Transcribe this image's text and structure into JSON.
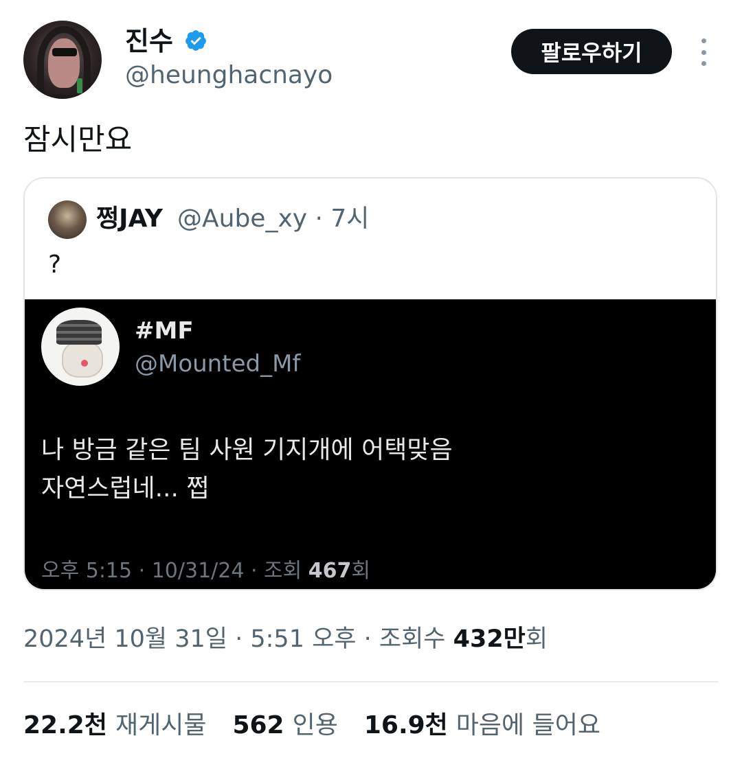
{
  "author": {
    "name": "진수",
    "handle": "@heunghacnayo",
    "verified": true,
    "verified_color": "#1d9bf0"
  },
  "follow_button": {
    "label": "팔로우하기"
  },
  "more_icon": "more-vertical-icon",
  "tweet": {
    "text": "잠시만요"
  },
  "quoted": {
    "name": "쩡JAY",
    "handle": "@Aube_xy",
    "time": "· 7시",
    "text": "?",
    "media": {
      "name": "#MF",
      "handle": "@Mounted_Mf",
      "text": "나 방금 같은 팀 사원 기지개에 어택맞음\n자연스럽네... 쩝",
      "meta_prefix": "오후 5:15 · 10/31/24 · 조회 ",
      "views": "467",
      "views_suffix": "회"
    }
  },
  "timestamp": {
    "text": "2024년 10월 31일 · 5:51 오후 · 조회수 ",
    "views": "432만",
    "suffix": "회"
  },
  "stats": {
    "retweets": {
      "value": "22.2천",
      "label": "재게시물"
    },
    "quotes": {
      "value": "562",
      "label": "인용"
    },
    "likes": {
      "value": "16.9천",
      "label": "마음에 들어요"
    }
  }
}
